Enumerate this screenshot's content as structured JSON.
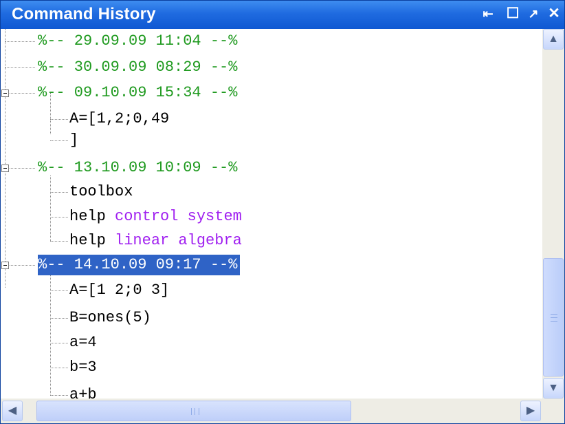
{
  "window": {
    "title": "Command History",
    "buttons": {
      "undock": "⇤",
      "maximize": "☐",
      "minimize": "↗",
      "close": "✕"
    }
  },
  "history": [
    {
      "type": "separator",
      "text": "%-- 29.09.09 11:04 --%",
      "expanded": false
    },
    {
      "type": "separator",
      "text": "%-- 30.09.09 08:29 --%",
      "expanded": false
    },
    {
      "type": "separator",
      "text": "%-- 09.10.09 15:34 --%",
      "expanded": true
    },
    {
      "type": "command",
      "text": "A=[1,2;0,49"
    },
    {
      "type": "command",
      "text": "]"
    },
    {
      "type": "separator",
      "text": "%-- 13.10.09 10:09 --%",
      "expanded": true
    },
    {
      "type": "command",
      "text": "toolbox"
    },
    {
      "type": "command",
      "cmd": "help ",
      "arg": "control system"
    },
    {
      "type": "command",
      "cmd": "help ",
      "arg": "linear algebra"
    },
    {
      "type": "separator",
      "text": "%-- 14.10.09 09:17 --%",
      "expanded": true,
      "selected": true
    },
    {
      "type": "command",
      "text": "A=[1 2;0 3]"
    },
    {
      "type": "command",
      "text": "B=ones(5)"
    },
    {
      "type": "command",
      "text": "a=4"
    },
    {
      "type": "command",
      "text": "b=3"
    },
    {
      "type": "command",
      "text": "a+b"
    }
  ],
  "scrollbars": {
    "vertical": {
      "up": "▲",
      "down": "▼",
      "position": 0.84
    },
    "horizontal": {
      "left": "◀",
      "right": "▶",
      "position": 0.0
    }
  },
  "colors": {
    "separator": "#1f9a1f",
    "keyword": "#a020f0",
    "selection": "#2f63c6",
    "titlebar": "#1f6be0"
  }
}
